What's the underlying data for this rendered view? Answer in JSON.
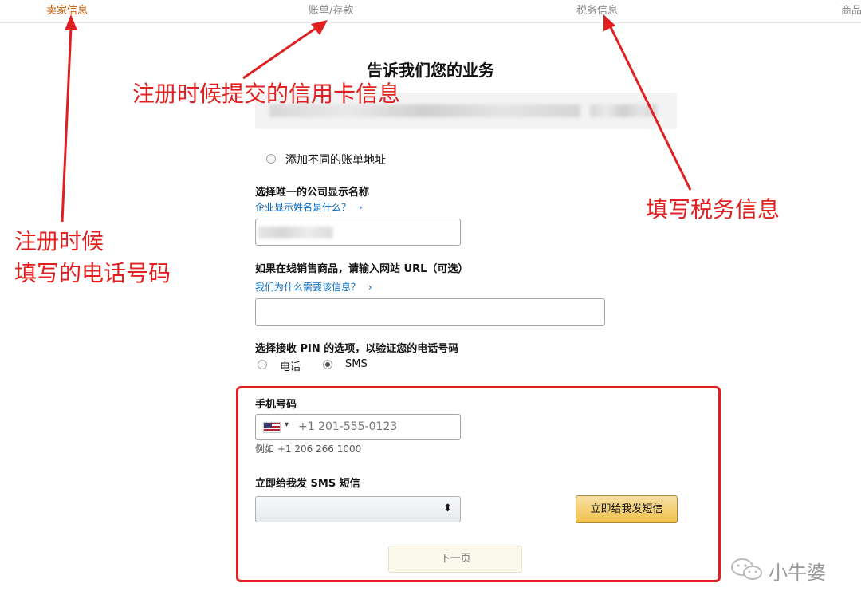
{
  "steps": [
    "卖家信息",
    "账单/存款",
    "税务信息",
    "商品"
  ],
  "page_title": "告诉我们您的业务",
  "billing": {
    "add_address_label": "添加不同的账单地址"
  },
  "company": {
    "label": "选择唯一的公司显示名称",
    "help_link": "企业显示姓名是什么？",
    "help_arrow": "›"
  },
  "website": {
    "label": "如果在线销售商品，请输入网站 URL（可选）",
    "help_link": "我们为什么需要该信息？",
    "help_arrow": "›"
  },
  "pin": {
    "label": "选择接收 PIN 的选项，以验证您的电话号码",
    "options": [
      "电话",
      "SMS"
    ],
    "selected": "SMS"
  },
  "phone": {
    "label": "手机号码",
    "placeholder": "+1 201-555-0123",
    "example": "例如 +1 206 266 1000",
    "caret": "▾"
  },
  "sms": {
    "label": "立即给我发 SMS 短信",
    "select_arrow": "⬍",
    "send_button": "立即给我发短信"
  },
  "next_button": "下一页",
  "annotations": {
    "credit_card": "注册时候提交的信用卡信息",
    "phone_line1": "注册时候",
    "phone_line2": "填写的电话号码",
    "tax": "填写税务信息"
  },
  "watermark": {
    "text": "小牛婆",
    "icon": "wechat-icon"
  },
  "colors": {
    "accent": "#c45500",
    "link": "#0066c0",
    "annotation": "#e02020",
    "button": "#f0c14b"
  }
}
